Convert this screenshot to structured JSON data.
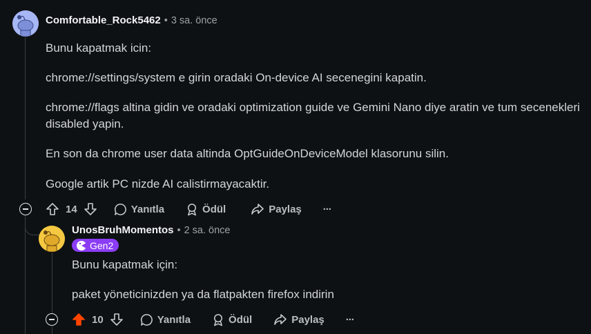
{
  "comments": [
    {
      "username": "Comfortable_Rock5462",
      "time": "3 sa. önce",
      "avatar_color": "#a7b6f5",
      "paragraphs": [
        "Bunu kapatmak icin:",
        "chrome://settings/system e girin oradaki On-device AI secenegini kapatin.",
        "chrome://flags altina gidin ve oradaki optimization guide ve Gemini Nano diye aratin ve tum secenekleri disabled yapin.",
        "En son da chrome user data altinda OptGuideOnDeviceModel klasorunu silin.",
        "Google artik PC nizde AI calistirmayacaktir."
      ],
      "votes": "14",
      "vote_state": "none",
      "reply_label": "Yanıtla",
      "award_label": "Ödül",
      "share_label": "Paylaş",
      "more_label": "···"
    },
    {
      "username": "UnosBruhMomentos",
      "time": "2 sa. önce",
      "avatar_color": "#f5c842",
      "flair": "Gen2",
      "flair_color": "#8b3df5",
      "paragraphs": [
        "Bunu kapatmak için:",
        "paket yöneticinizden ya da flatpakten firefox indirin"
      ],
      "votes": "10",
      "vote_state": "upvoted",
      "upvote_color": "#ff4500",
      "reply_label": "Yanıtla",
      "award_label": "Ödül",
      "share_label": "Paylaş",
      "more_label": "···"
    }
  ]
}
